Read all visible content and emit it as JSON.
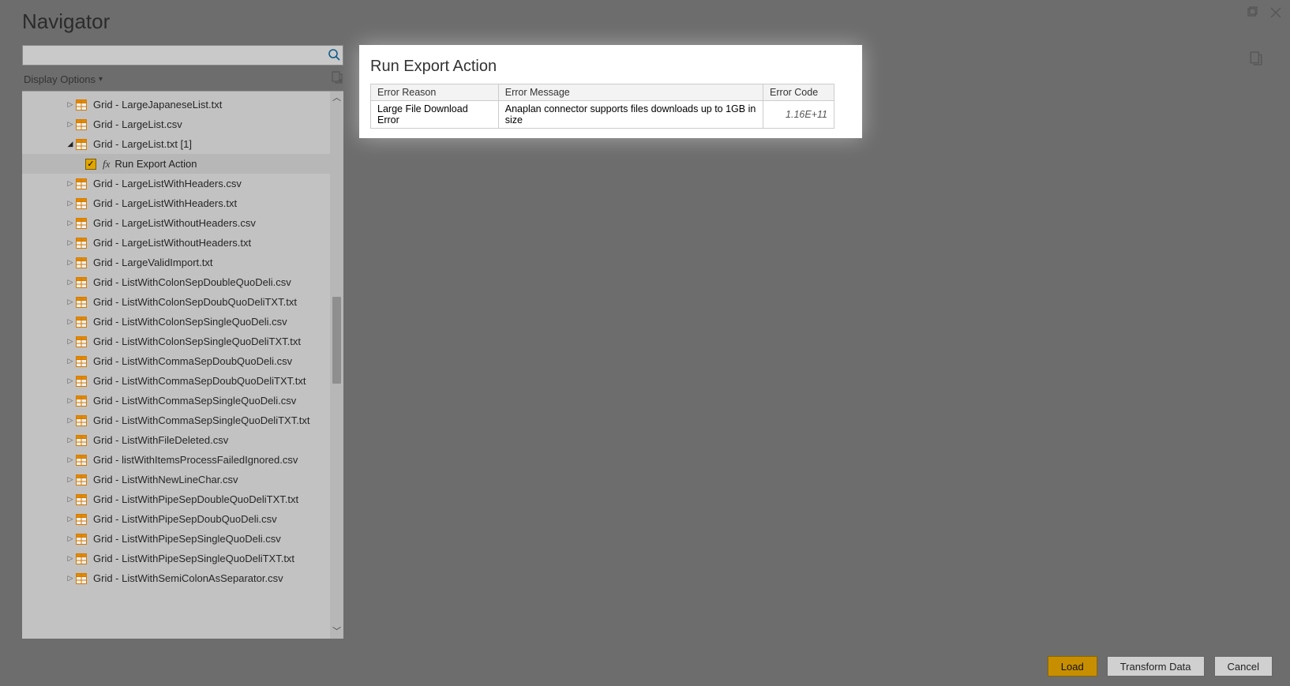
{
  "window": {
    "title": "Navigator"
  },
  "sidebar": {
    "search_placeholder": "",
    "display_options": "Display Options",
    "items": [
      {
        "label": "Grid - LargeJapaneseList.txt",
        "type": "node"
      },
      {
        "label": "Grid - LargeList.csv",
        "type": "node"
      },
      {
        "label": "Grid - LargeList.txt [1]",
        "type": "expanded"
      },
      {
        "label": "Run Export Action",
        "type": "child_checked"
      },
      {
        "label": "Grid - LargeListWithHeaders.csv",
        "type": "node"
      },
      {
        "label": "Grid - LargeListWithHeaders.txt",
        "type": "node"
      },
      {
        "label": "Grid - LargeListWithoutHeaders.csv",
        "type": "node"
      },
      {
        "label": "Grid - LargeListWithoutHeaders.txt",
        "type": "node"
      },
      {
        "label": "Grid - LargeValidImport.txt",
        "type": "node"
      },
      {
        "label": "Grid - ListWithColonSepDoubleQuoDeli.csv",
        "type": "node"
      },
      {
        "label": "Grid - ListWithColonSepDoubQuoDeliTXT.txt",
        "type": "node"
      },
      {
        "label": "Grid - ListWithColonSepSingleQuoDeli.csv",
        "type": "node"
      },
      {
        "label": "Grid - ListWithColonSepSingleQuoDeliTXT.txt",
        "type": "node"
      },
      {
        "label": "Grid - ListWithCommaSepDoubQuoDeli.csv",
        "type": "node"
      },
      {
        "label": "Grid - ListWithCommaSepDoubQuoDeliTXT.txt",
        "type": "node"
      },
      {
        "label": "Grid - ListWithCommaSepSingleQuoDeli.csv",
        "type": "node"
      },
      {
        "label": "Grid - ListWithCommaSepSingleQuoDeliTXT.txt",
        "type": "node"
      },
      {
        "label": "Grid - ListWithFileDeleted.csv",
        "type": "node"
      },
      {
        "label": "Grid - listWithItemsProcessFailedIgnored.csv",
        "type": "node"
      },
      {
        "label": "Grid - ListWithNewLineChar.csv",
        "type": "node"
      },
      {
        "label": "Grid - ListWithPipeSepDoubleQuoDeliTXT.txt",
        "type": "node"
      },
      {
        "label": "Grid - ListWithPipeSepDoubQuoDeli.csv",
        "type": "node"
      },
      {
        "label": "Grid - ListWithPipeSepSingleQuoDeli.csv",
        "type": "node"
      },
      {
        "label": "Grid - ListWithPipeSepSingleQuoDeliTXT.txt",
        "type": "node"
      },
      {
        "label": "Grid - ListWithSemiColonAsSeparator.csv",
        "type": "node"
      }
    ]
  },
  "preview": {
    "title": "Run Export Action",
    "columns": [
      "Error Reason",
      "Error Message",
      "Error Code"
    ],
    "rows": [
      {
        "reason": "Large File Download Error",
        "message": "Anaplan connector supports files downloads up to 1GB in size",
        "code": "1.16E+11"
      }
    ]
  },
  "footer": {
    "load": "Load",
    "transform": "Transform Data",
    "cancel": "Cancel"
  }
}
